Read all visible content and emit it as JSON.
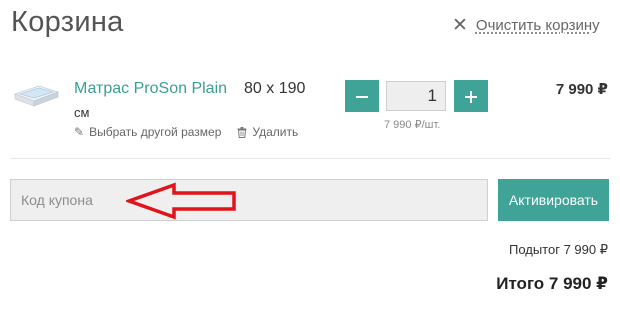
{
  "header": {
    "title": "Корзина",
    "clear_label": "Очистить корзину"
  },
  "cart_item": {
    "name": "Матрас ProSon Plain",
    "size": "80 х 190",
    "unit": "см",
    "change_size_label": "Выбрать другой размер",
    "delete_label": "Удалить",
    "quantity": "1",
    "unit_price": "7 990 ₽/шт.",
    "line_total": "7 990 ₽"
  },
  "coupon": {
    "placeholder": "Код купона",
    "activate_label": "Активировать"
  },
  "summary": {
    "subtotal": "Подытог 7 990 ₽",
    "total": "Итого 7 990 ₽"
  },
  "icons": {
    "clear": "close-icon",
    "change_size": "pencil-icon",
    "delete": "trash-icon",
    "decrease": "minus-icon",
    "increase": "plus-icon"
  },
  "colors": {
    "accent": "#3fa497",
    "link": "#3a9e93",
    "annotation_arrow": "#e0151b"
  }
}
